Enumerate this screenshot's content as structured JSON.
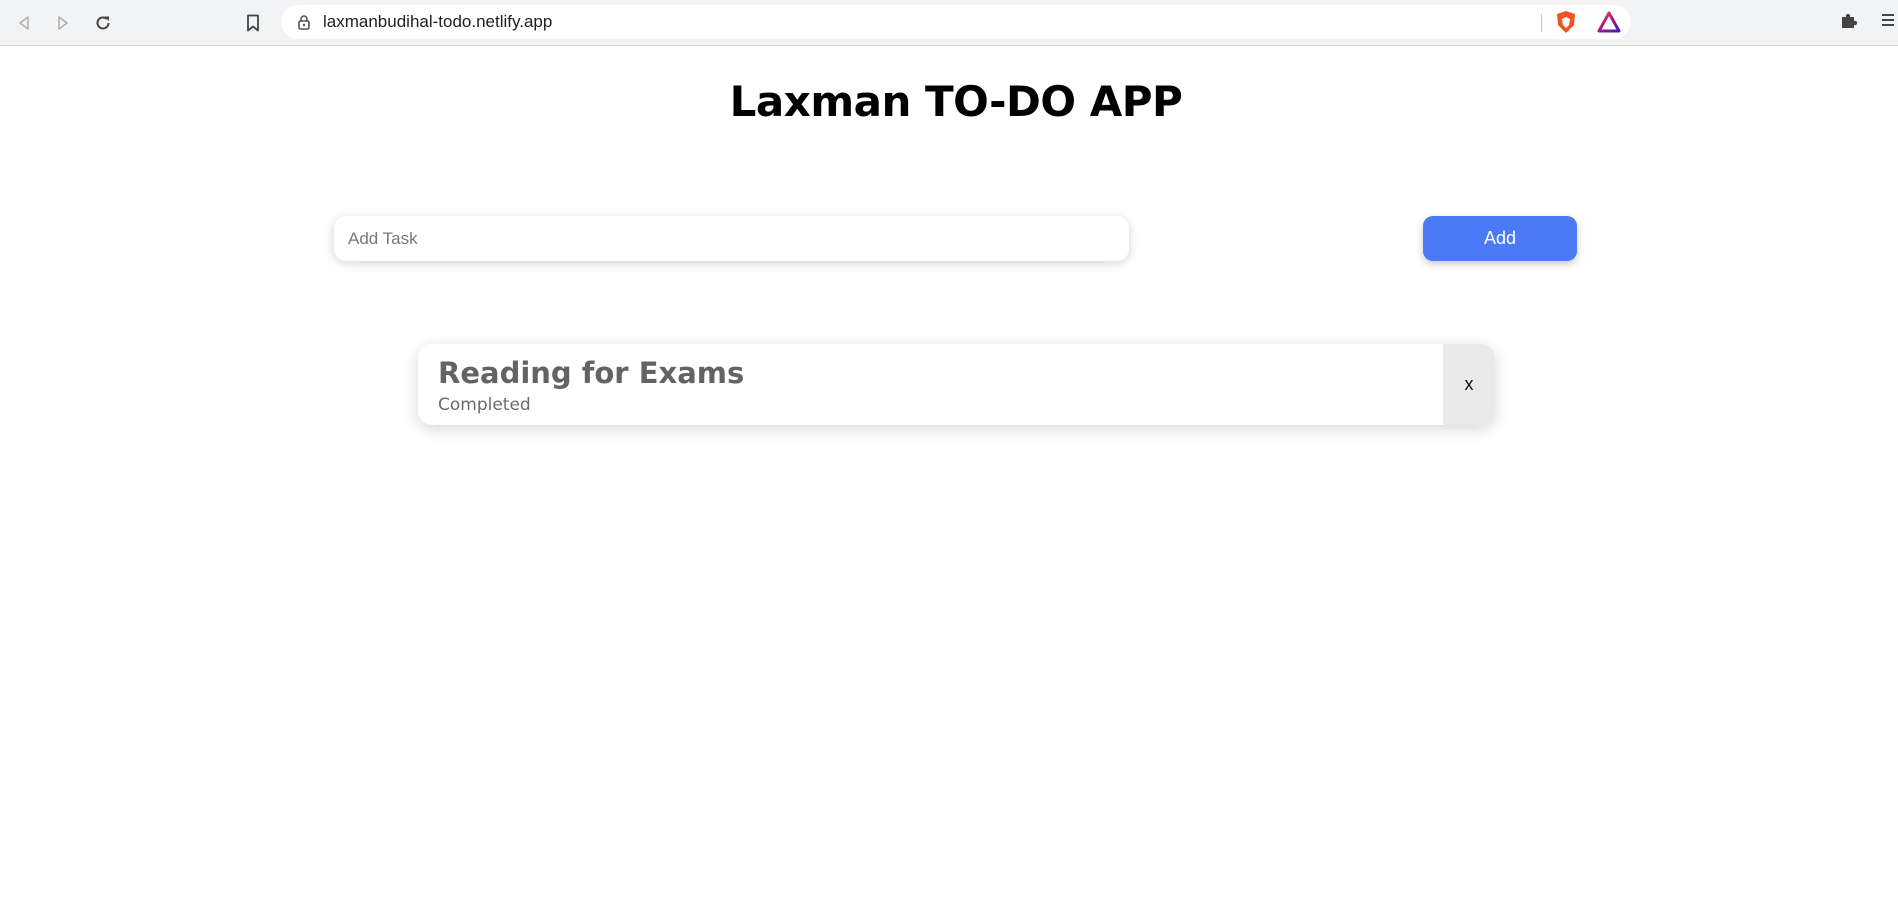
{
  "browser": {
    "url": "laxmanbudihal-todo.netlify.app",
    "icons": [
      "back-icon",
      "forward-icon",
      "reload-icon",
      "bookmark-icon",
      "lock-icon",
      "brave-shield-icon",
      "brave-rewards-icon",
      "extensions-icon",
      "menu-icon"
    ]
  },
  "app": {
    "title": "Laxman TO-DO APP",
    "input": {
      "placeholder": "Add Task",
      "value": ""
    },
    "add_label": "Add",
    "colors": {
      "add_button": "#4a7af5"
    }
  },
  "tasks": [
    {
      "name": "Reading for Exams",
      "status": "Completed",
      "delete_label": "x"
    }
  ]
}
